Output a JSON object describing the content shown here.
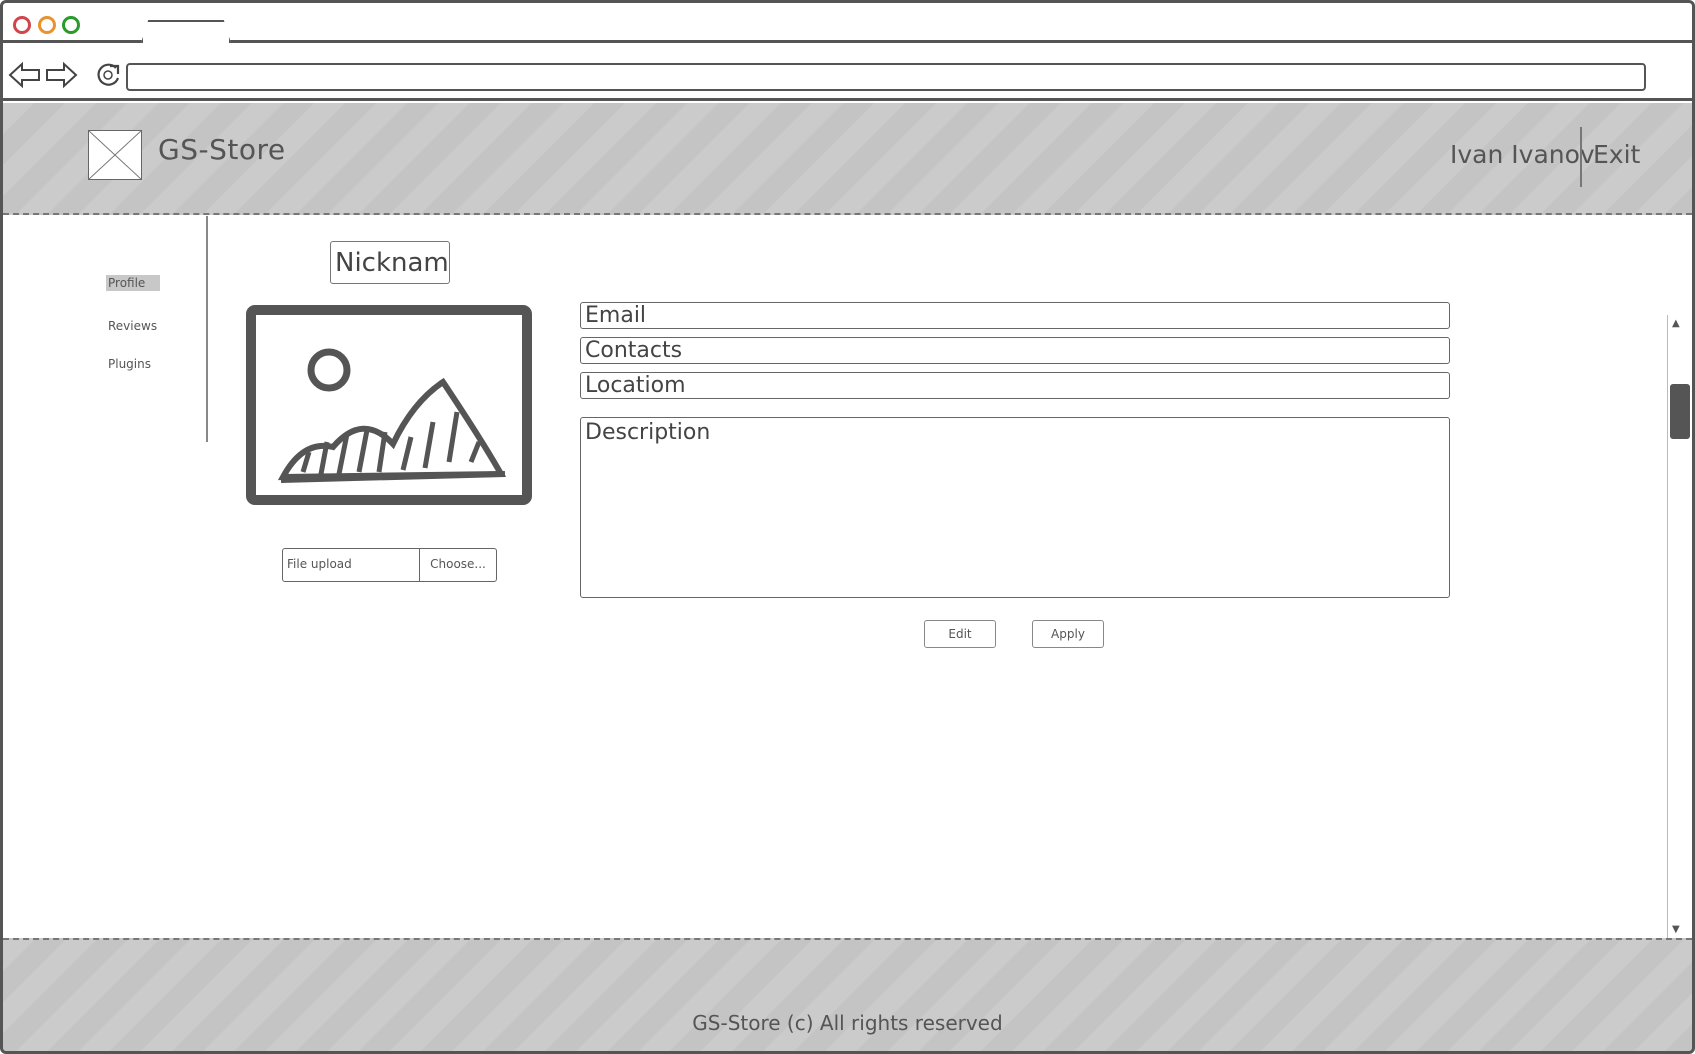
{
  "app": {
    "brand": "GS-Store",
    "user_name": "Ivan Ivanov",
    "exit_label": "Exit"
  },
  "sidebar": {
    "items": [
      {
        "label": "Profile"
      },
      {
        "label": "Reviews"
      },
      {
        "label": "Plugins"
      }
    ]
  },
  "profile": {
    "nickname": "Nickname",
    "fields": {
      "email": "Email",
      "contacts": "Contacts",
      "location": "Locatiom",
      "description": "Description"
    },
    "file_upload": {
      "label": "File upload",
      "button": "Choose..."
    },
    "buttons": {
      "edit": "Edit",
      "apply": "Apply"
    }
  },
  "footer": {
    "text": "GS-Store (c) All rights reserved"
  },
  "colors": {
    "close_dot": "#d0464a",
    "minimize_dot": "#e8932f",
    "maximize_dot": "#2a9a2a",
    "bar_stripe": "#c8c8c8"
  },
  "icons": [
    "back-arrow-icon",
    "forward-arrow-icon",
    "reload-icon",
    "image-placeholder-icon"
  ]
}
